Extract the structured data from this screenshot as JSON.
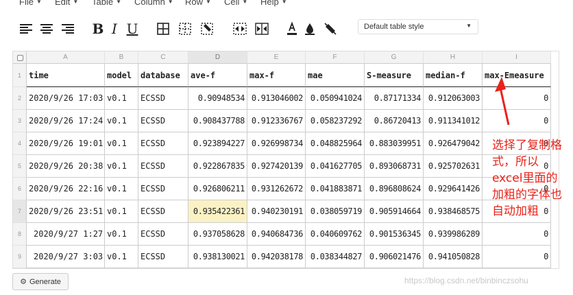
{
  "menu": [
    {
      "label": "File"
    },
    {
      "label": "Edit"
    },
    {
      "label": "Table"
    },
    {
      "label": "Column"
    },
    {
      "label": "Row"
    },
    {
      "label": "Cell"
    },
    {
      "label": "Help"
    }
  ],
  "toolbar": {
    "bold_label": "B",
    "italic_label": "I",
    "underline_label": "U",
    "table_style": "Default table style"
  },
  "grid": {
    "col_letters": [
      "A",
      "B",
      "C",
      "D",
      "E",
      "F",
      "G",
      "H",
      "I"
    ],
    "row_numbers": [
      "1",
      "2",
      "3",
      "4",
      "5",
      "6",
      "7",
      "8",
      "9"
    ],
    "rows": [
      [
        "time",
        "model",
        "database",
        "ave-f",
        "max-f",
        "mae",
        "S-measure",
        "median-f",
        "max-Emeasure"
      ],
      [
        "2020/9/26 17:03",
        "v0.1",
        "ECSSD",
        "0.90948534",
        "0.913046002",
        "0.050941024",
        "0.87171334",
        "0.912063003",
        "0"
      ],
      [
        "2020/9/26 17:24",
        "v0.1",
        "ECSSD",
        "0.908437788",
        "0.912336767",
        "0.058237292",
        "0.86720413",
        "0.911341012",
        "0"
      ],
      [
        "2020/9/26 19:01",
        "v0.1",
        "ECSSD",
        "0.923894227",
        "0.926998734",
        "0.048825964",
        "0.883039951",
        "0.926479042",
        "0"
      ],
      [
        "2020/9/26 20:38",
        "v0.1",
        "ECSSD",
        "0.922867835",
        "0.927420139",
        "0.041627705",
        "0.893068731",
        "0.925702631",
        "0"
      ],
      [
        "2020/9/26 22:16",
        "v0.1",
        "ECSSD",
        "0.926806211",
        "0.931262672",
        "0.041883871",
        "0.896808624",
        "0.929641426",
        "0"
      ],
      [
        "2020/9/26 23:51",
        "v0.1",
        "ECSSD",
        "0.935422361",
        "0.940230191",
        "0.038059719",
        "0.905914664",
        "0.938468575",
        "0"
      ],
      [
        "2020/9/27 1:27",
        "v0.1",
        "ECSSD",
        "0.937058628",
        "0.940684736",
        "0.040609762",
        "0.901536345",
        "0.939986289",
        "0"
      ],
      [
        "2020/9/27 3:03",
        "v0.1",
        "ECSSD",
        "0.938130021",
        "0.942038178",
        "0.038344827",
        "0.906021476",
        "0.941050828",
        "0"
      ]
    ]
  },
  "annotation": "选择了复制格式，所以excel里面的加粗的字体也自动加粗",
  "generate_label": "Generate",
  "watermark": "https://blog.csdn.net/binbinczsohu",
  "colors": {
    "annotation": "#e8231a",
    "highlight": "#faf2c4"
  }
}
